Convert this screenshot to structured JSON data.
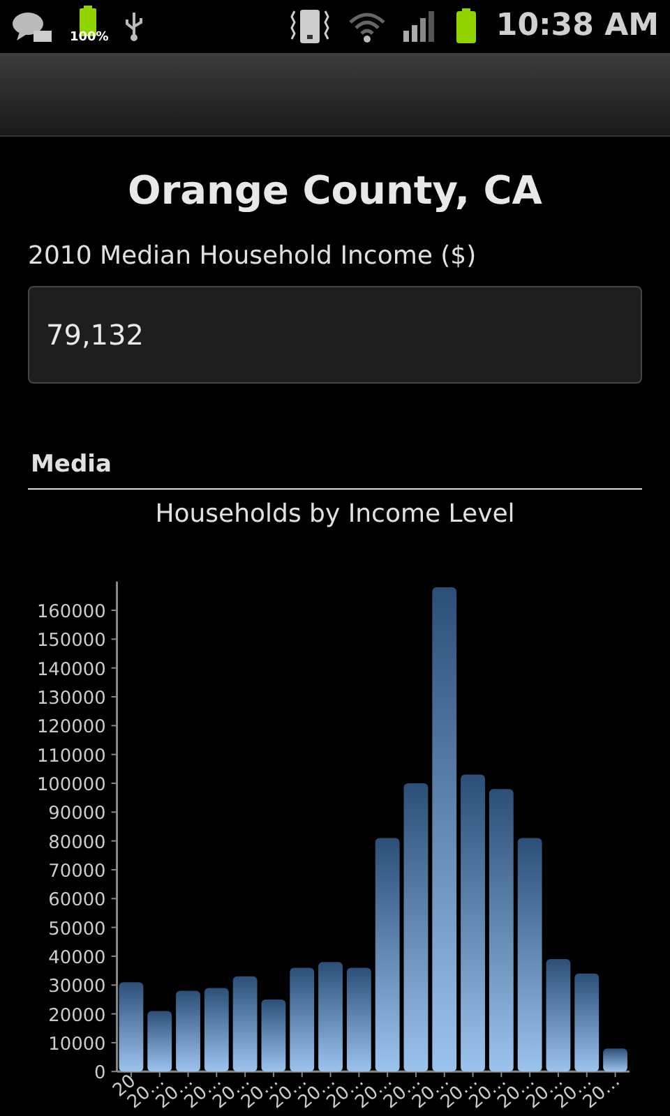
{
  "status_bar": {
    "battery_label": "100%",
    "time": "10:38 AM"
  },
  "title": "Orange County, CA",
  "field": {
    "label": "2010 Median Household Income ($)",
    "value": "79,132"
  },
  "section": {
    "title": "Media"
  },
  "chart": {
    "title": "Households by Income Level",
    "chart_data": {
      "type": "bar",
      "categories": [
        "20",
        "20…",
        "20…",
        "20…",
        "20…",
        "20…",
        "20…",
        "20…",
        "20…",
        "20…",
        "20…",
        "20…",
        "20…",
        "20…",
        "20…",
        "20…",
        "20…",
        "20…"
      ],
      "series": [
        {
          "color": "#9cc3ee",
          "values": [
            31000,
            21000,
            28000,
            29000,
            33000,
            25000,
            36000,
            38000,
            36000,
            81000,
            100000,
            168000,
            103000,
            98000,
            81000,
            39000,
            34000,
            8000
          ]
        }
      ],
      "ylim": [
        0,
        170000
      ],
      "yticks": [
        0,
        10000,
        20000,
        30000,
        40000,
        50000,
        60000,
        70000,
        80000,
        90000,
        100000,
        110000,
        120000,
        130000,
        140000,
        150000,
        160000
      ]
    }
  }
}
